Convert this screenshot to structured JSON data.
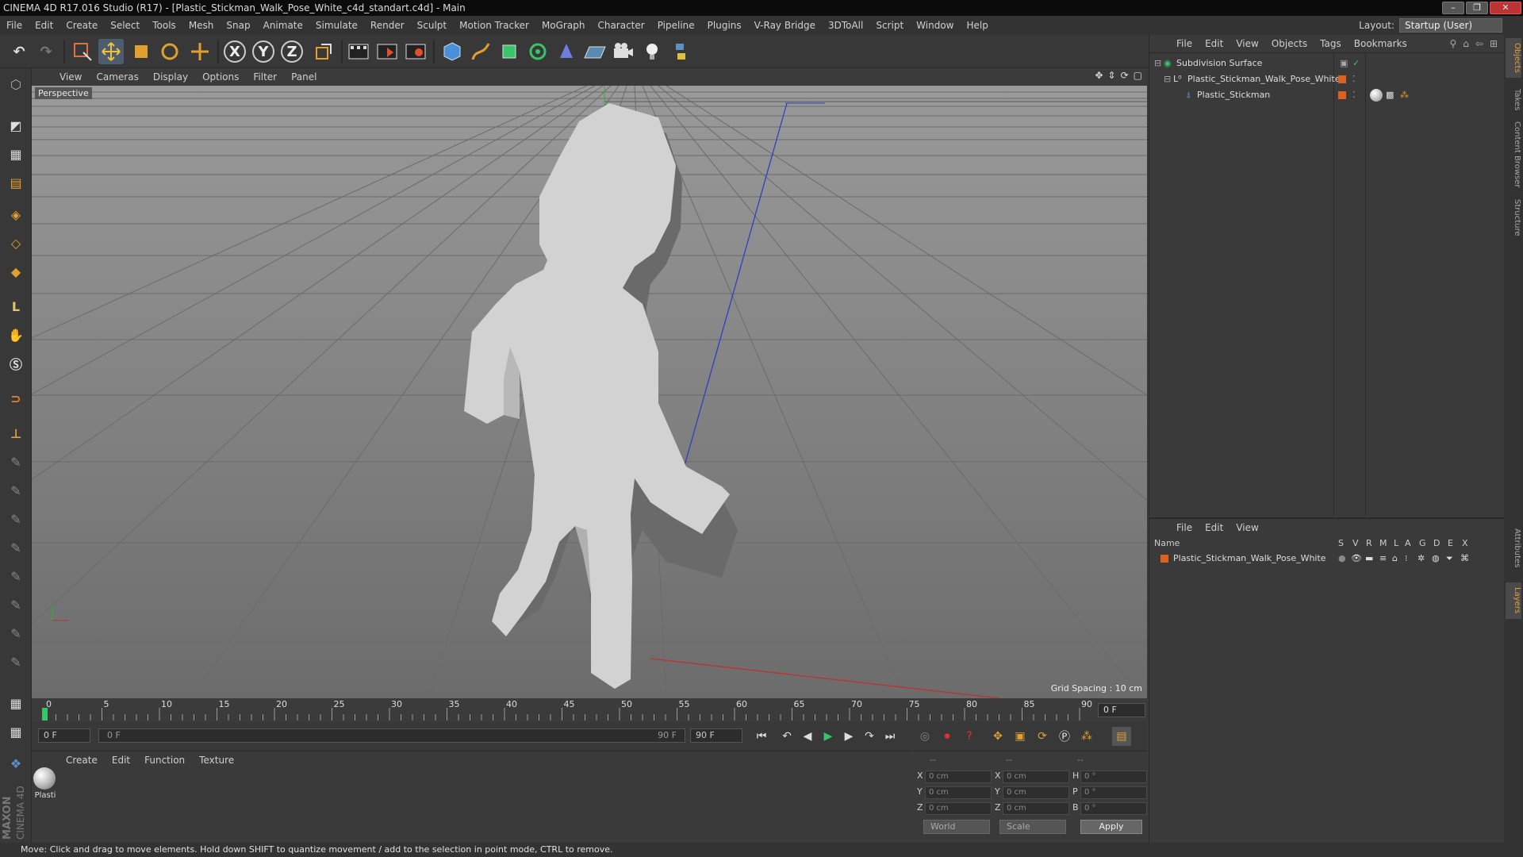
{
  "window": {
    "title": "CINEMA 4D R17.016 Studio (R17) - [Plastic_Stickman_Walk_Pose_White_c4d_standart.c4d] - Main"
  },
  "menu": [
    "File",
    "Edit",
    "Create",
    "Select",
    "Tools",
    "Mesh",
    "Snap",
    "Animate",
    "Simulate",
    "Render",
    "Sculpt",
    "Motion Tracker",
    "MoGraph",
    "Character",
    "Pipeline",
    "Plugins",
    "V-Ray Bridge",
    "3DToAll",
    "Script",
    "Window",
    "Help"
  ],
  "layout": {
    "label": "Layout:",
    "value": "Startup (User)"
  },
  "toolbar": {
    "x_axis": "X",
    "y_axis": "Y",
    "z_axis": "Z"
  },
  "viewport": {
    "menu": [
      "View",
      "Cameras",
      "Display",
      "Options",
      "Filter",
      "Panel"
    ],
    "label": "Perspective",
    "grid_spacing": "Grid Spacing : 10 cm"
  },
  "timeline": {
    "ticks": [
      "0",
      "5",
      "10",
      "15",
      "20",
      "25",
      "30",
      "35",
      "40",
      "45",
      "50",
      "55",
      "60",
      "65",
      "70",
      "75",
      "80",
      "85",
      "90"
    ],
    "current_frame_field": "0 F",
    "start_field": "0 F",
    "range_start": "0 F",
    "range_end": "90 F",
    "end_field": "90 F"
  },
  "material_manager": {
    "menu": [
      "Create",
      "Edit",
      "Function",
      "Texture"
    ],
    "materials": [
      {
        "name": "Plasti"
      }
    ]
  },
  "coordinates": {
    "headers": [
      "--",
      "--",
      "--"
    ],
    "rows": [
      {
        "l1": "X",
        "v1": "0 cm",
        "l2": "X",
        "v2": "0 cm",
        "l3": "H",
        "v3": "0 °"
      },
      {
        "l1": "Y",
        "v1": "0 cm",
        "l2": "Y",
        "v2": "0 cm",
        "l3": "P",
        "v3": "0 °"
      },
      {
        "l1": "Z",
        "v1": "0 cm",
        "l2": "Z",
        "v2": "0 cm",
        "l3": "B",
        "v3": "0 °"
      }
    ],
    "mode": "World",
    "transform": "Scale",
    "apply": "Apply"
  },
  "object_manager": {
    "menu": [
      "File",
      "Edit",
      "View",
      "Objects",
      "Tags",
      "Bookmarks"
    ],
    "objects": [
      {
        "name": "Subdivision Surface"
      },
      {
        "name": "Plastic_Stickman_Walk_Pose_White"
      },
      {
        "name": "Plastic_Stickman"
      }
    ]
  },
  "layer_manager": {
    "menu": [
      "File",
      "Edit",
      "View"
    ],
    "columns": [
      "Name",
      "S",
      "V",
      "R",
      "M",
      "L",
      "A",
      "G",
      "D",
      "E",
      "X"
    ],
    "layers": [
      {
        "name": "Plastic_Stickman_Walk_Pose_White"
      }
    ]
  },
  "right_tabs": [
    "Objects",
    "Takes",
    "Content Browser",
    "Structure",
    "Attributes",
    "Layers"
  ],
  "branding": {
    "maxon": "MAXON",
    "product": "CINEMA 4D"
  },
  "status": "Move: Click and drag to move elements. Hold down SHIFT to quantize movement / add to the selection in point mode, CTRL to remove.",
  "colors": {
    "accent": "#e0a040",
    "viewport_bg": "#7e7e7e",
    "layer_color": "#e06020",
    "grid_line": "#6b6b6b"
  }
}
